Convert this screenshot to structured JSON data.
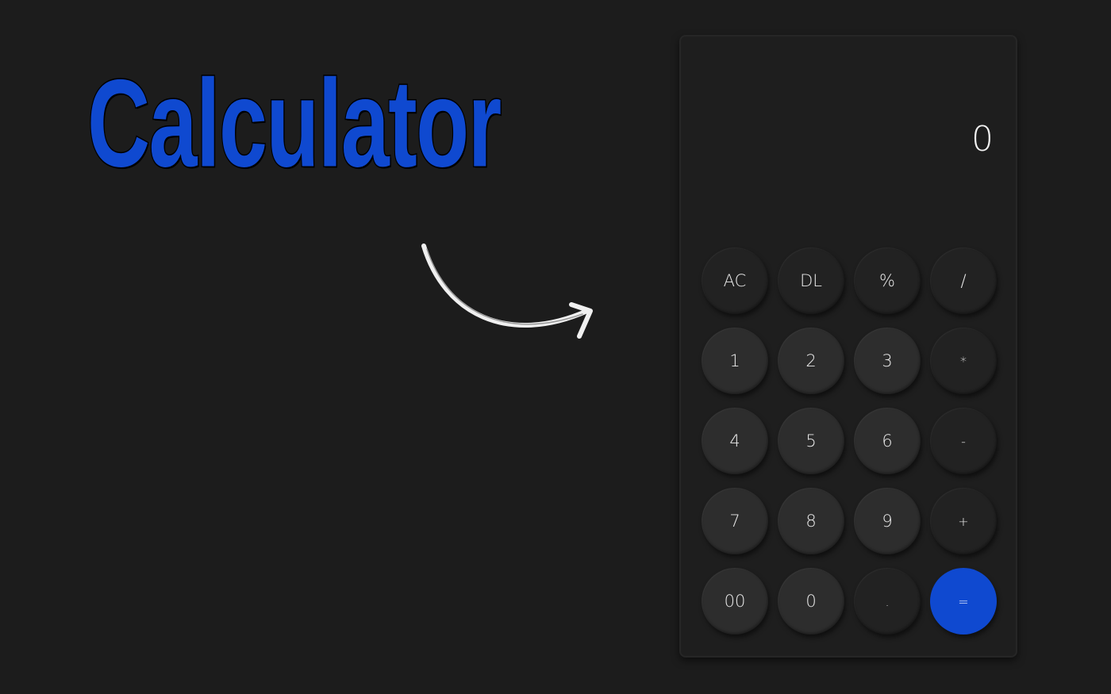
{
  "title": "Calculator",
  "display": {
    "value": "0"
  },
  "keys": {
    "row1": [
      "AC",
      "DL",
      "%",
      "/"
    ],
    "row2": [
      "1",
      "2",
      "3",
      "*"
    ],
    "row3": [
      "4",
      "5",
      "6",
      "-"
    ],
    "row4": [
      "7",
      "8",
      "9",
      "+"
    ],
    "row5": [
      "00",
      "0",
      ".",
      "="
    ]
  },
  "colors": {
    "background": "#1c1c1c",
    "accent": "#0f49d0",
    "key": "#2d2d2d"
  }
}
